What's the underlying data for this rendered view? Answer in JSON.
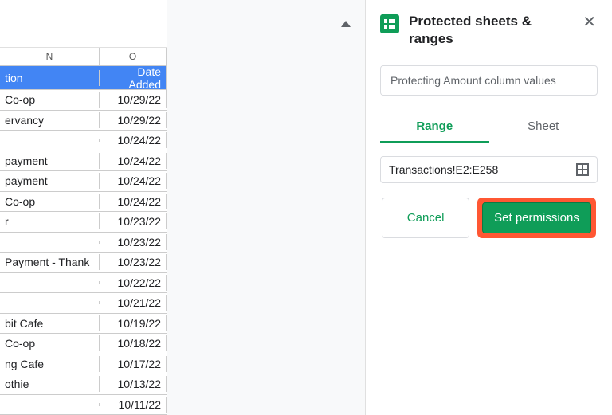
{
  "sheet": {
    "col_letters": [
      "N",
      "O"
    ],
    "header_row": [
      "tion",
      "Date Added"
    ],
    "rows": [
      [
        "Co-op",
        "10/29/22"
      ],
      [
        "ervancy",
        "10/29/22"
      ],
      [
        "",
        "10/24/22"
      ],
      [
        "payment",
        "10/24/22"
      ],
      [
        "payment",
        "10/24/22"
      ],
      [
        "Co-op",
        "10/24/22"
      ],
      [
        "r",
        "10/23/22"
      ],
      [
        "",
        "10/23/22"
      ],
      [
        "Payment - Thank",
        "10/23/22"
      ],
      [
        "",
        "10/22/22"
      ],
      [
        "",
        "10/21/22"
      ],
      [
        "bit Cafe",
        "10/19/22"
      ],
      [
        "Co-op",
        "10/18/22"
      ],
      [
        "ng Cafe",
        "10/17/22"
      ],
      [
        "othie",
        "10/13/22"
      ],
      [
        "",
        "10/11/22"
      ]
    ]
  },
  "panel": {
    "title": "Protected sheets & ranges",
    "description": "Protecting Amount column values",
    "tabs": {
      "range": "Range",
      "sheet": "Sheet"
    },
    "range_value": "Transactions!E2:E258",
    "cancel": "Cancel",
    "set_permissions": "Set permissions"
  }
}
